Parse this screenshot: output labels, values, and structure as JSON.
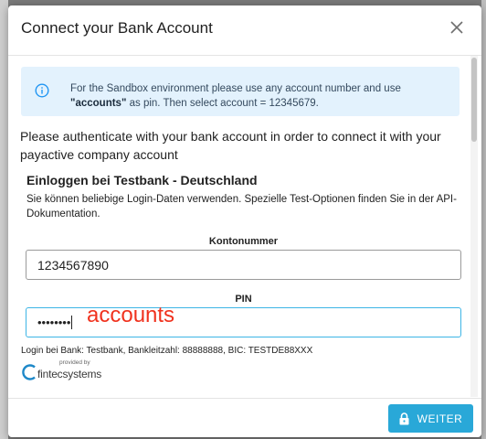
{
  "modal": {
    "title": "Connect your Bank Account",
    "close_icon": "close-icon"
  },
  "info": {
    "icon": "info-icon",
    "text_before": "For the Sandbox environment please use any account number and use ",
    "text_bold": "\"accounts\"",
    "text_after": " as pin. Then select account = 12345679."
  },
  "auth_text": "Please authenticate with your bank account in order to connect it with your payactive company account",
  "bank": {
    "title": "Einloggen bei Testbank - Deutschland",
    "description": "Sie können beliebige Login-Daten verwenden. Spezielle Test-Optionen finden Sie in der API-Dokumentation."
  },
  "form": {
    "account_label": "Kontonummer",
    "account_value": "1234567890",
    "pin_label": "PIN",
    "pin_masked": "••••••••"
  },
  "annotation": "accounts",
  "login_info": "Login bei Bank: Testbank, Bankleitzahl: 88888888, BIC: TESTDE88XXX",
  "logo": {
    "small": "provided by",
    "main": "fintecsystems"
  },
  "footer": {
    "button_label": "WEITER",
    "button_icon": "lock-icon"
  },
  "colors": {
    "primary": "#29a8d8",
    "info_bg": "#e3f2fd",
    "annotation": "#f0321e"
  }
}
